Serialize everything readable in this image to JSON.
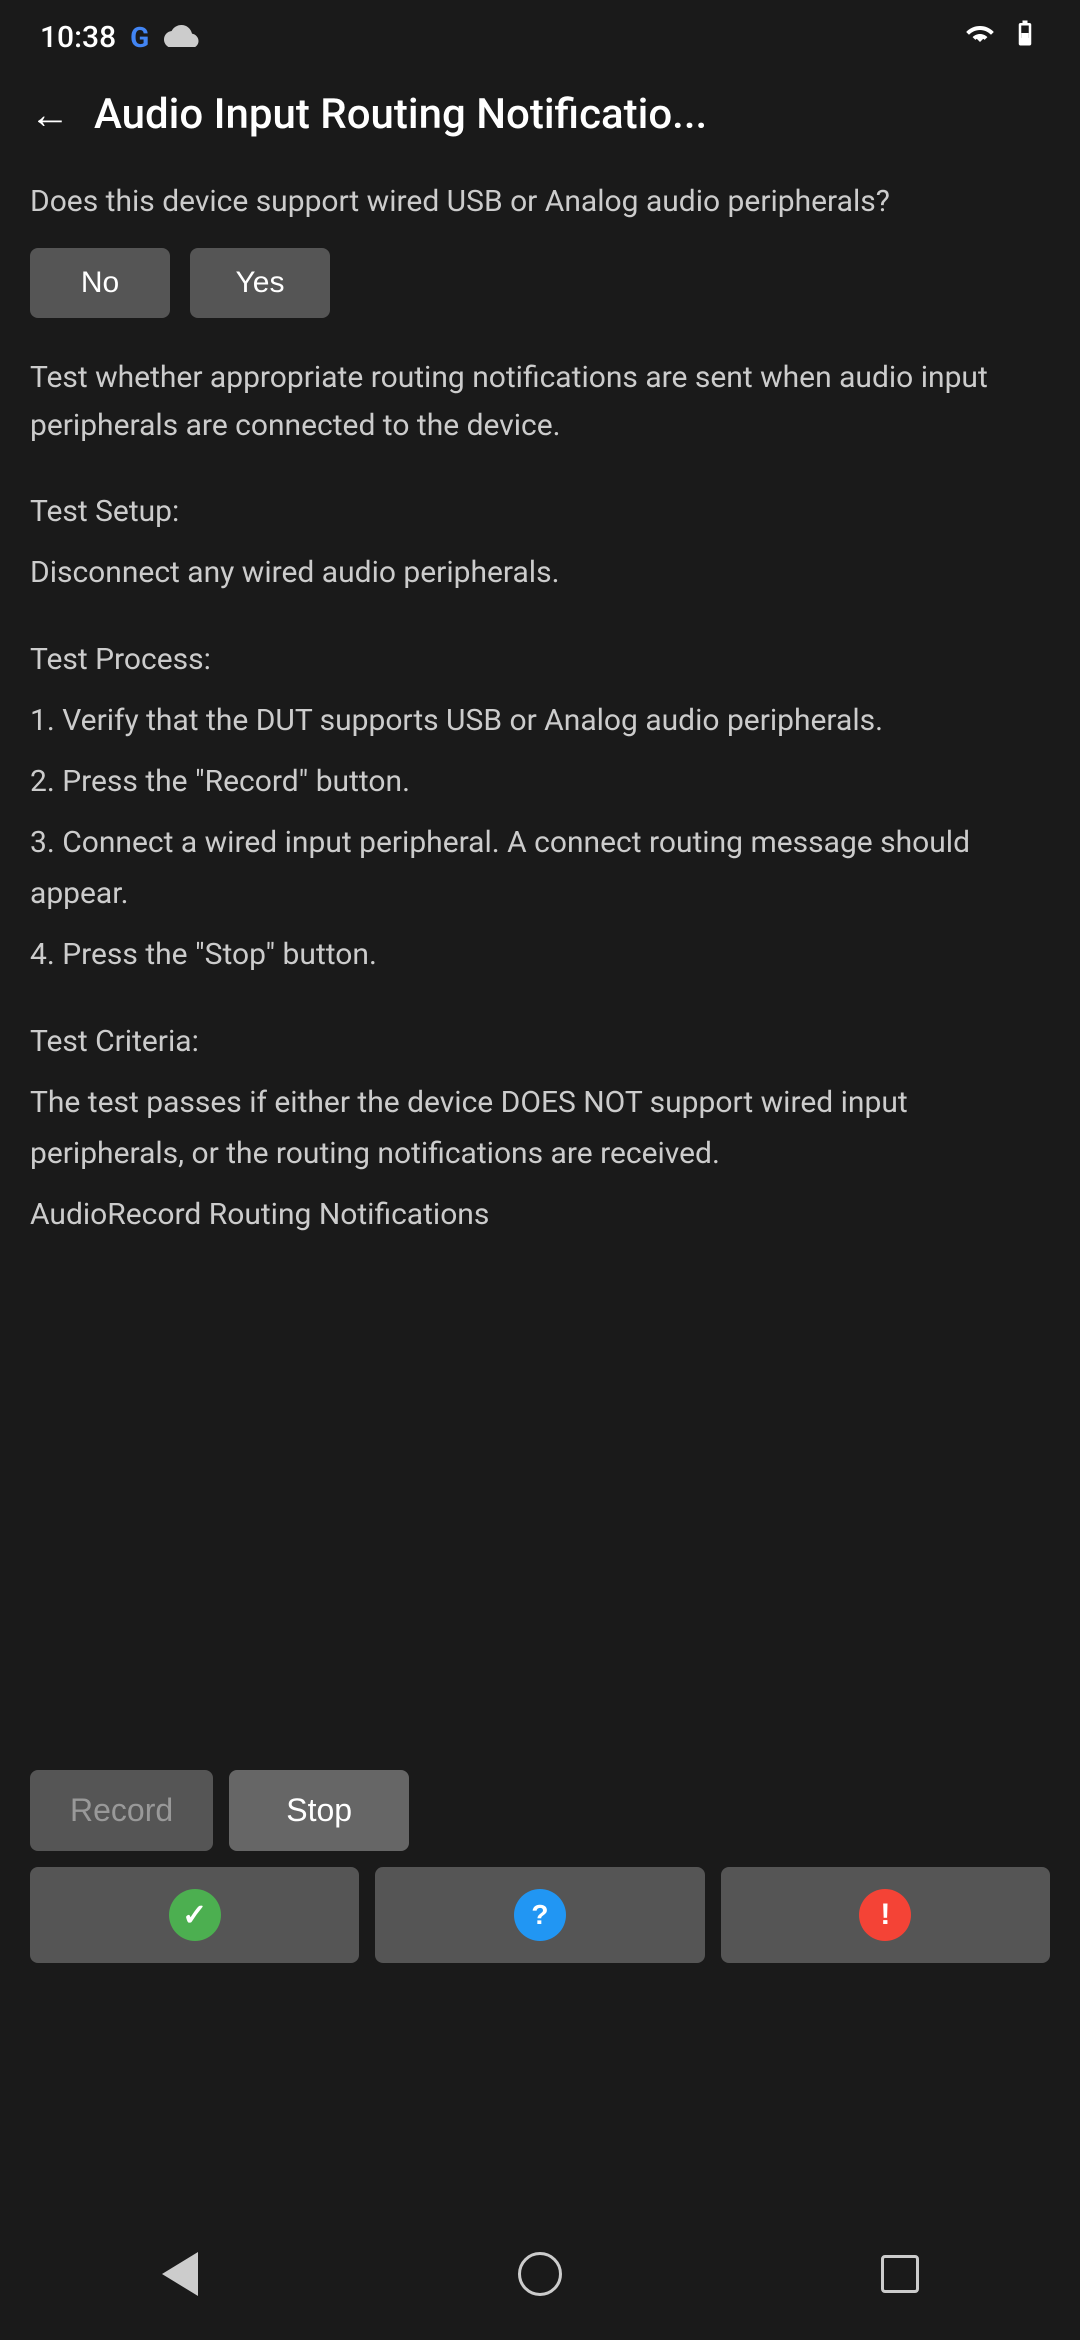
{
  "statusBar": {
    "time": "10:38",
    "googleLogo": "G"
  },
  "header": {
    "backLabel": "←",
    "title": "Audio Input Routing Notificatio..."
  },
  "question": {
    "text": "Does this device support wired USB or Analog audio peripherals?"
  },
  "buttons": {
    "no": "No",
    "yes": "Yes"
  },
  "description": "Test whether appropriate routing notifications are sent when audio input peripherals are connected to the device.",
  "testSetup": {
    "label": "Test Setup:",
    "text": "Disconnect any wired audio peripherals."
  },
  "testProcess": {
    "label": "Test Process:",
    "step1": "1. Verify that the DUT supports USB or Analog audio peripherals.",
    "step2": "2. Press the \"Record\" button.",
    "step3": "3. Connect a wired input peripheral. A connect routing message should appear.",
    "step4": "4. Press the \"Stop\" button."
  },
  "testCriteria": {
    "label": "Test Criteria:",
    "text": "The test passes if either the device DOES NOT support wired input peripherals, or the routing notifications are received.",
    "appName": "AudioRecord Routing Notifications"
  },
  "actionButtons": {
    "record": "Record",
    "stop": "Stop"
  },
  "resultButtons": {
    "pass": "✓",
    "info": "?",
    "fail": "!"
  },
  "navBar": {
    "back": "back",
    "home": "home",
    "recents": "recents"
  }
}
